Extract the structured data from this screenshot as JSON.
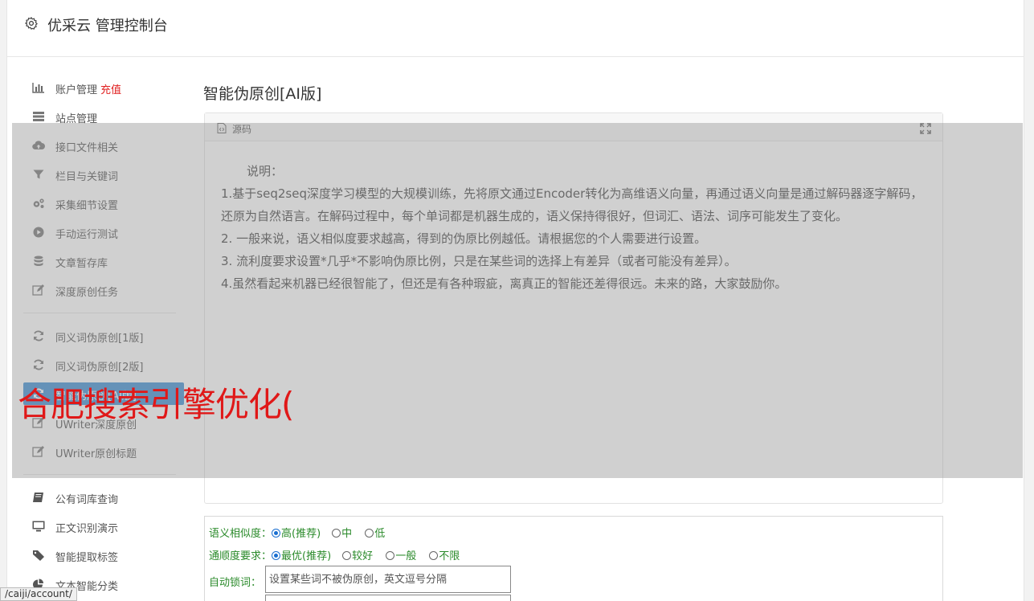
{
  "header": {
    "title": "优采云 管理控制台",
    "icon": "gear-icon"
  },
  "sidebar": {
    "items": [
      {
        "label": "账户管理",
        "badge": "充值",
        "icon": "bar-chart-icon"
      },
      {
        "label": "站点管理",
        "icon": "server-icon"
      },
      {
        "label": "接口文件相关",
        "icon": "cloud-upload-icon"
      },
      {
        "label": "栏目与关键词",
        "icon": "filter-icon"
      },
      {
        "label": "采集细节设置",
        "icon": "gears-icon"
      },
      {
        "label": "手动运行测试",
        "icon": "play-circle-icon"
      },
      {
        "label": "文章暂存库",
        "icon": "database-icon"
      },
      {
        "label": "深度原创任务",
        "icon": "edit-icon"
      },
      {
        "label": "同义词伪原创[1版]",
        "icon": "refresh-icon"
      },
      {
        "label": "同义词伪原创[2版]",
        "icon": "refresh-icon"
      },
      {
        "label": "智能伪原创[AI版]",
        "icon": "refresh-icon"
      },
      {
        "label": "UWriter深度原创",
        "icon": "edit-icon"
      },
      {
        "label": "UWriter原创标题",
        "icon": "edit-icon"
      },
      {
        "label": "公有词库查询",
        "icon": "book-icon"
      },
      {
        "label": "正文识别演示",
        "icon": "monitor-icon"
      },
      {
        "label": "智能提取标签",
        "icon": "tag-icon"
      },
      {
        "label": "文本智能分类",
        "icon": "pie-chart-icon"
      }
    ]
  },
  "main": {
    "title": "智能伪原创[AI版]",
    "editor": {
      "source_label": "源码",
      "lines": [
        "说明：",
        "1.基于seq2seq深度学习模型的大规模训练，先将原文通过Encoder转化为高维语义向量，再通过语义向量是通过解码器逐字解码，还原为自然语言。在解码过程中，每个单词都是机器生成的，语义保持得很好，但词汇、语法、词序可能发生了变化。",
        "2. 一般来说，语义相似度要求越高，得到的伪原比例越低。请根据您的个人需要进行设置。",
        "3. 流利度要求设置*几乎*不影响伪原比例，只是在某些词的选择上有差异（或者可能没有差异）。",
        "4.虽然看起来机器已经很智能了，但还是有各种瑕疵，离真正的智能还差得很远。未来的路，大家鼓励你。"
      ]
    },
    "form": {
      "similarity": {
        "label": "语义相似度：",
        "options": [
          "高(推荐)",
          "中",
          "低"
        ],
        "selected": 0
      },
      "fluency": {
        "label": "通顺度要求：",
        "options": [
          "最优(推荐)",
          "较好",
          "一般",
          "不限"
        ],
        "selected": 0
      },
      "lock": {
        "label": "自动锁词：",
        "placeholder": "设置某些词不被伪原创，英文逗号分隔"
      }
    }
  },
  "overlay": {
    "watermark": "合肥搜索引擎优化("
  },
  "status_bar": {
    "url": "/caiji/account/"
  }
}
